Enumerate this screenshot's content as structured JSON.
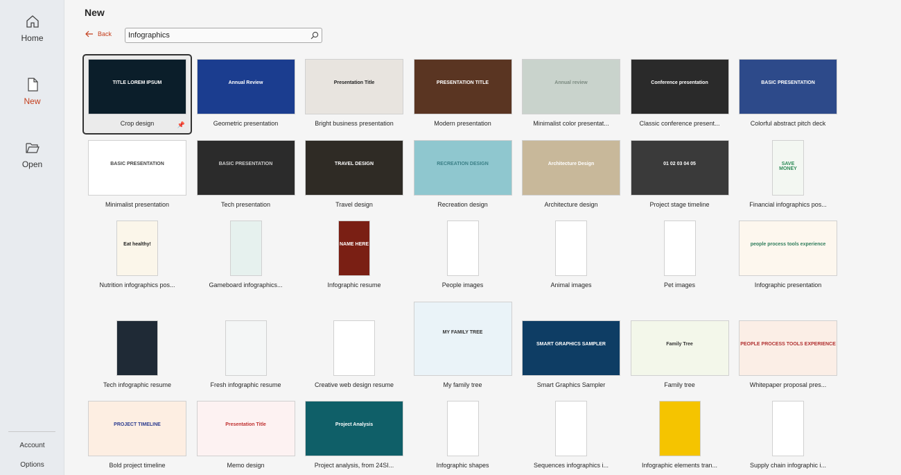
{
  "sidebar": {
    "items": [
      {
        "label": "Home",
        "icon": "home-icon"
      },
      {
        "label": "New",
        "icon": "new-file-icon",
        "active": true
      },
      {
        "label": "Open",
        "icon": "folder-open-icon"
      }
    ],
    "bottom": [
      {
        "label": "Account"
      },
      {
        "label": "Options"
      }
    ]
  },
  "header": {
    "title": "New",
    "back_label": "Back",
    "search_value": "Infographics"
  },
  "accent": "#c43e1c",
  "rows": [
    [
      {
        "name": "Crop design",
        "bg": "#0b1e2a",
        "fg": "#ffffff",
        "shape": "land",
        "text": "TITLE LOREM IPSUM",
        "selected": true
      },
      {
        "name": "Geometric presentation",
        "bg": "#1b3d8f",
        "fg": "#ffffff",
        "shape": "land",
        "text": "Annual Review"
      },
      {
        "name": "Bright business presentation",
        "bg": "#e8e4df",
        "fg": "#222222",
        "shape": "land",
        "text": "Presentation Title"
      },
      {
        "name": "Modern presentation",
        "bg": "#5a3522",
        "fg": "#ffffff",
        "shape": "land",
        "text": "PRESENTATION TITLE"
      },
      {
        "name": "Minimalist color presentat...",
        "bg": "#c9d3cc",
        "fg": "#7b8a80",
        "shape": "land",
        "text": "Annual review"
      },
      {
        "name": "Classic conference present...",
        "bg": "#2a2a2a",
        "fg": "#ffffff",
        "shape": "land",
        "text": "Conference presentation"
      },
      {
        "name": "Colorful abstract pitch deck",
        "bg": "#2d4a8a",
        "fg": "#ffffff",
        "shape": "land",
        "text": "BASIC PRESENTATION"
      }
    ],
    [
      {
        "name": "Minimalist presentation",
        "bg": "#ffffff",
        "fg": "#444444",
        "shape": "land",
        "text": "BASIC PRESENTATION"
      },
      {
        "name": "Tech presentation",
        "bg": "#2b2b2b",
        "fg": "#cccccc",
        "shape": "land",
        "text": "BASIC PRESENTATION"
      },
      {
        "name": "Travel design",
        "bg": "#2f2b25",
        "fg": "#ffffff",
        "shape": "land",
        "text": "TRAVEL DESIGN"
      },
      {
        "name": "Recreation design",
        "bg": "#8fc7cf",
        "fg": "#3a7f86",
        "shape": "land",
        "text": "RECREATION DESIGN"
      },
      {
        "name": "Architecture design",
        "bg": "#c8b89a",
        "fg": "#ffffff",
        "shape": "land",
        "text": "Architecture Design"
      },
      {
        "name": "Project stage timeline",
        "bg": "#3a3a3a",
        "fg": "#ffffff",
        "shape": "land",
        "text": "01 02 03 04 05"
      },
      {
        "name": "Financial infographics pos...",
        "bg": "#f3f7f2",
        "fg": "#2e8b57",
        "shape": "port",
        "text": "SAVE MONEY"
      }
    ],
    [
      {
        "name": "Nutrition infographics pos...",
        "bg": "#fbf6ea",
        "fg": "#222222",
        "shape": "wport",
        "text": "Eat healthy!"
      },
      {
        "name": "Gameboard infographics...",
        "bg": "#e6f1ee",
        "fg": "#333333",
        "shape": "port",
        "text": ""
      },
      {
        "name": "Infographic resume",
        "bg": "#7a1f14",
        "fg": "#ffffff",
        "shape": "port",
        "text": "NAME HERE"
      },
      {
        "name": "People images",
        "bg": "#ffffff",
        "fg": "#333333",
        "shape": "port",
        "text": ""
      },
      {
        "name": "Animal images",
        "bg": "#ffffff",
        "fg": "#333333",
        "shape": "port",
        "text": ""
      },
      {
        "name": "Pet images",
        "bg": "#ffffff",
        "fg": "#333333",
        "shape": "port",
        "text": ""
      },
      {
        "name": "Infographic presentation",
        "bg": "#fdf7ee",
        "fg": "#2e7d5b",
        "shape": "land",
        "text": "people process tools experience"
      }
    ],
    [
      {
        "name": "Tech infographic resume",
        "bg": "#1f2a36",
        "fg": "#f2d13a",
        "shape": "wport",
        "text": ""
      },
      {
        "name": "Fresh infographic resume",
        "bg": "#f4f6f6",
        "fg": "#333333",
        "shape": "wport",
        "text": ""
      },
      {
        "name": "Creative web design resume",
        "bg": "#ffffff",
        "fg": "#b03030",
        "shape": "wport",
        "text": ""
      },
      {
        "name": "My family tree",
        "bg": "#eaf3f8",
        "fg": "#333333",
        "shape": "tall",
        "text": "MY FAMILY TREE"
      },
      {
        "name": "Smart Graphics Sampler",
        "bg": "#0e3d64",
        "fg": "#ffffff",
        "shape": "land",
        "text": "SMART GRAPHICS SAMPLER"
      },
      {
        "name": "Family tree",
        "bg": "#f3f7ea",
        "fg": "#333333",
        "shape": "land",
        "text": "Family Tree"
      },
      {
        "name": "Whitepaper proposal pres...",
        "bg": "#fbeee6",
        "fg": "#b03030",
        "shape": "land",
        "text": "PEOPLE PROCESS TOOLS EXPERIENCE"
      }
    ],
    [
      {
        "name": "Bold project timeline",
        "bg": "#fdeee2",
        "fg": "#2b3b8f",
        "shape": "land",
        "text": "PROJECT TIMELINE"
      },
      {
        "name": "Memo design",
        "bg": "#fdf2f2",
        "fg": "#c03030",
        "shape": "land",
        "text": "Presentation Title"
      },
      {
        "name": "Project analysis, from 24SI...",
        "bg": "#0f5f68",
        "fg": "#ffffff",
        "shape": "land",
        "text": "Project Analysis"
      },
      {
        "name": "Infographic shapes",
        "bg": "#ffffff",
        "fg": "#333333",
        "shape": "port",
        "text": ""
      },
      {
        "name": "Sequences infographics i...",
        "bg": "#ffffff",
        "fg": "#333333",
        "shape": "port",
        "text": ""
      },
      {
        "name": "Infographic elements tran...",
        "bg": "#f5c400",
        "fg": "#333333",
        "shape": "wport",
        "text": ""
      },
      {
        "name": "Supply chain infographic i...",
        "bg": "#ffffff",
        "fg": "#333333",
        "shape": "port",
        "text": ""
      }
    ]
  ]
}
